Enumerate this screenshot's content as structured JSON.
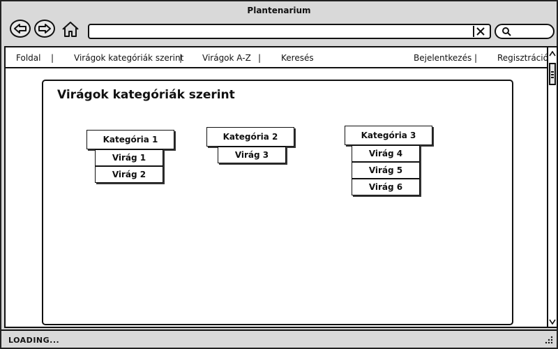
{
  "window": {
    "title": "Plantenarium"
  },
  "nav": {
    "items": [
      {
        "label": "Foldal"
      },
      {
        "label": "Virágok kategóriák szerint"
      },
      {
        "label": "Virágok A-Z"
      },
      {
        "label": "Keresés"
      },
      {
        "label": "Bejelentkezés"
      },
      {
        "label": "Regisztráció"
      }
    ],
    "separator": "|"
  },
  "url": {
    "value": ""
  },
  "panel": {
    "title": "Virágok kategóriák szerint"
  },
  "categories": [
    {
      "label": "Kategória 1",
      "flowers": [
        "Virág 1",
        "Virág 2"
      ]
    },
    {
      "label": "Kategória 2",
      "flowers": [
        "Virág 3"
      ]
    },
    {
      "label": "Kategória 3",
      "flowers": [
        "Virág 4",
        "Virág 5",
        "Virág 6"
      ]
    }
  ],
  "status": {
    "text": "LOADING..."
  }
}
